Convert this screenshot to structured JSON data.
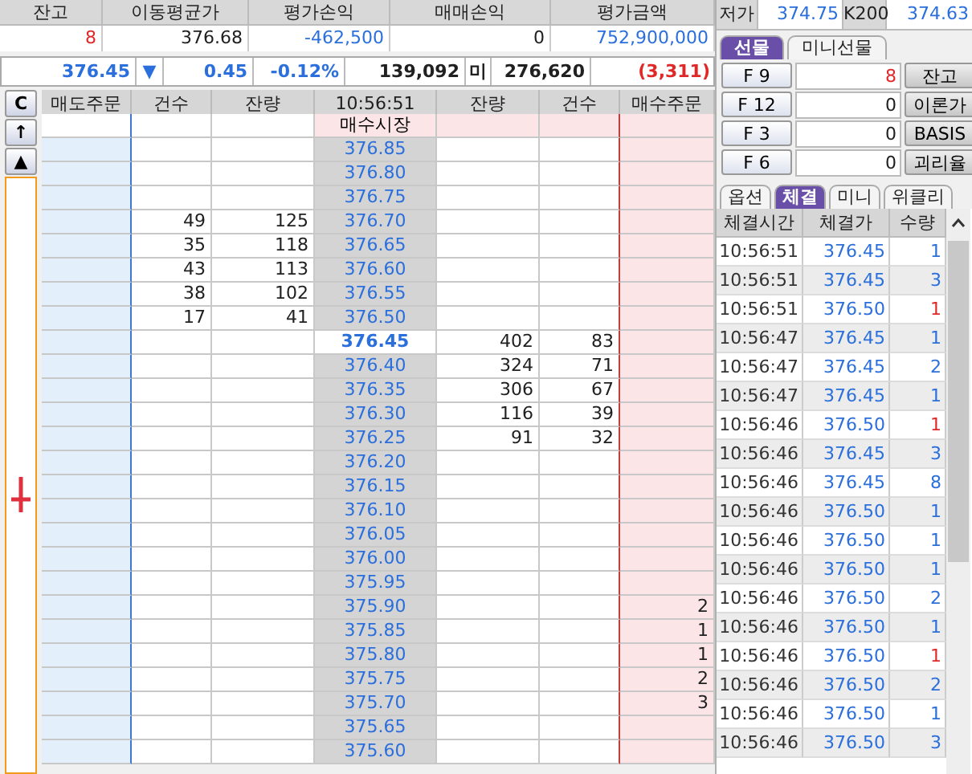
{
  "summary": {
    "columns": [
      "잔고",
      "이동평균가",
      "평가손익",
      "매매손익",
      "평가금액"
    ],
    "values": [
      {
        "text": "8",
        "color": "#e02828"
      },
      {
        "text": "376.68",
        "color": "#202020"
      },
      {
        "text": "-462,500",
        "color": "#2a6fdc"
      },
      {
        "text": "0",
        "color": "#202020"
      },
      {
        "text": "752,900,000",
        "color": "#2a6fdc"
      }
    ]
  },
  "ticker": {
    "price": "376.45",
    "direction": "▼",
    "change": "0.45",
    "rate": "-0.12%",
    "volume": "139,092",
    "oi_label": "미",
    "open_interest": "276,620",
    "oi_change": "(3,311)"
  },
  "side_buttons": [
    "C",
    "↑",
    "▲"
  ],
  "order_book": {
    "columns": [
      "매도주문",
      "건수",
      "잔량",
      "10:56:51",
      "잔량",
      "건수",
      "매수주문"
    ],
    "rows": [
      {
        "kind": "market",
        "price": "매수시장"
      },
      {
        "kind": "level",
        "price": "376.85"
      },
      {
        "kind": "level",
        "price": "376.80"
      },
      {
        "kind": "level",
        "price": "376.75"
      },
      {
        "kind": "level",
        "price": "376.70",
        "ask_count": "49",
        "ask_qty": "125"
      },
      {
        "kind": "level",
        "price": "376.65",
        "ask_count": "35",
        "ask_qty": "118"
      },
      {
        "kind": "level",
        "price": "376.60",
        "ask_count": "43",
        "ask_qty": "113"
      },
      {
        "kind": "level",
        "price": "376.55",
        "ask_count": "38",
        "ask_qty": "102"
      },
      {
        "kind": "level",
        "price": "376.50",
        "ask_count": "17",
        "ask_qty": "41"
      },
      {
        "kind": "current",
        "price": "376.45",
        "bid_qty": "402",
        "bid_count": "83"
      },
      {
        "kind": "level",
        "price": "376.40",
        "bid_qty": "324",
        "bid_count": "71"
      },
      {
        "kind": "level",
        "price": "376.35",
        "bid_qty": "306",
        "bid_count": "67"
      },
      {
        "kind": "level",
        "price": "376.30",
        "bid_qty": "116",
        "bid_count": "39"
      },
      {
        "kind": "level",
        "price": "376.25",
        "bid_qty": "91",
        "bid_count": "32"
      },
      {
        "kind": "level",
        "price": "376.20"
      },
      {
        "kind": "level",
        "price": "376.15"
      },
      {
        "kind": "level",
        "price": "376.10"
      },
      {
        "kind": "level",
        "price": "376.05"
      },
      {
        "kind": "level",
        "price": "376.00"
      },
      {
        "kind": "level",
        "price": "375.95"
      },
      {
        "kind": "level",
        "price": "375.90",
        "buy_order": "2"
      },
      {
        "kind": "level",
        "price": "375.85",
        "buy_order": "1"
      },
      {
        "kind": "level",
        "price": "375.80",
        "buy_order": "1"
      },
      {
        "kind": "level",
        "price": "375.75",
        "buy_order": "2"
      },
      {
        "kind": "level",
        "price": "375.70",
        "buy_order": "3"
      },
      {
        "kind": "level",
        "price": "375.65"
      },
      {
        "kind": "level",
        "price": "375.60"
      }
    ]
  },
  "quote": {
    "low_label": "저가",
    "low": "374.75",
    "index_label": "K200",
    "index": "374.63"
  },
  "product_tabs": [
    {
      "label": "선물",
      "selected": true
    },
    {
      "label": "미니선물",
      "selected": false
    }
  ],
  "fkeys": [
    {
      "key": "F 9",
      "value": "8",
      "color": "#e02828",
      "action": "잔고"
    },
    {
      "key": "F 12",
      "value": "0",
      "color": "#202020",
      "action": "이론가"
    },
    {
      "key": "F 3",
      "value": "0",
      "color": "#202020",
      "action": "BASIS"
    },
    {
      "key": "F 6",
      "value": "0",
      "color": "#202020",
      "action": "괴리율"
    }
  ],
  "trade_tabs": [
    {
      "label": "옵션",
      "selected": false
    },
    {
      "label": "체결",
      "selected": true
    },
    {
      "label": "미니",
      "selected": false
    },
    {
      "label": "위클리",
      "selected": false
    }
  ],
  "trades": {
    "columns": [
      "체결시간",
      "체결가",
      "수량"
    ],
    "rows": [
      {
        "time": "10:56:51",
        "price": "376.45",
        "qty": "1",
        "color": "#2a6fdc"
      },
      {
        "time": "10:56:51",
        "price": "376.45",
        "qty": "3",
        "color": "#2a6fdc"
      },
      {
        "time": "10:56:51",
        "price": "376.50",
        "qty": "1",
        "color": "#e02828"
      },
      {
        "time": "10:56:47",
        "price": "376.45",
        "qty": "1",
        "color": "#2a6fdc"
      },
      {
        "time": "10:56:47",
        "price": "376.45",
        "qty": "2",
        "color": "#2a6fdc"
      },
      {
        "time": "10:56:47",
        "price": "376.45",
        "qty": "1",
        "color": "#2a6fdc"
      },
      {
        "time": "10:56:46",
        "price": "376.50",
        "qty": "1",
        "color": "#e02828"
      },
      {
        "time": "10:56:46",
        "price": "376.45",
        "qty": "3",
        "color": "#2a6fdc"
      },
      {
        "time": "10:56:46",
        "price": "376.45",
        "qty": "8",
        "color": "#2a6fdc"
      },
      {
        "time": "10:56:46",
        "price": "376.50",
        "qty": "1",
        "color": "#2a6fdc"
      },
      {
        "time": "10:56:46",
        "price": "376.50",
        "qty": "1",
        "color": "#2a6fdc"
      },
      {
        "time": "10:56:46",
        "price": "376.50",
        "qty": "1",
        "color": "#2a6fdc"
      },
      {
        "time": "10:56:46",
        "price": "376.50",
        "qty": "2",
        "color": "#2a6fdc"
      },
      {
        "time": "10:56:46",
        "price": "376.50",
        "qty": "1",
        "color": "#2a6fdc"
      },
      {
        "time": "10:56:46",
        "price": "376.50",
        "qty": "1",
        "color": "#e02828"
      },
      {
        "time": "10:56:46",
        "price": "376.50",
        "qty": "2",
        "color": "#2a6fdc"
      },
      {
        "time": "10:56:46",
        "price": "376.50",
        "qty": "1",
        "color": "#2a6fdc"
      },
      {
        "time": "10:56:46",
        "price": "376.50",
        "qty": "3",
        "color": "#2a6fdc"
      }
    ]
  }
}
